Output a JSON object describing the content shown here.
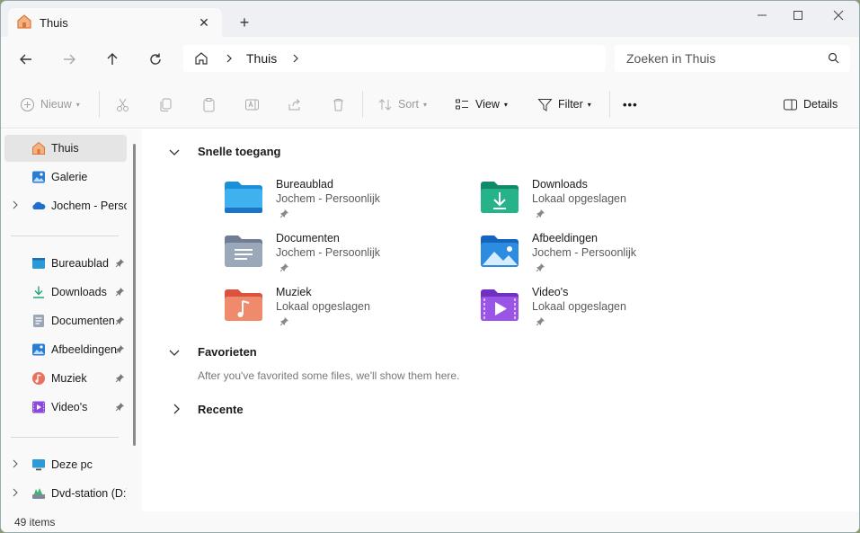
{
  "tab": {
    "title": "Thuis",
    "close": "✕",
    "new": "+"
  },
  "window": {
    "minimize": "—",
    "maximize": "☐",
    "close": "✕"
  },
  "nav": {
    "crumb": "Thuis"
  },
  "search": {
    "placeholder": "Zoeken in Thuis"
  },
  "toolbar": {
    "new": "Nieuw",
    "sort": "Sort",
    "view": "View",
    "filter": "Filter",
    "more": "•••",
    "details": "Details"
  },
  "sidebar": {
    "top": [
      {
        "label": "Thuis",
        "icon": "home-icon",
        "selected": true
      },
      {
        "label": "Galerie",
        "icon": "gallery-icon"
      },
      {
        "label": "Jochem - Persoonlijk",
        "icon": "onedrive-icon",
        "expandable": true
      }
    ],
    "pinned": [
      {
        "label": "Bureaublad",
        "icon": "desktop-icon"
      },
      {
        "label": "Downloads",
        "icon": "downloads-icon"
      },
      {
        "label": "Documenten",
        "icon": "documents-icon"
      },
      {
        "label": "Afbeeldingen",
        "icon": "pictures-icon"
      },
      {
        "label": "Muziek",
        "icon": "music-icon"
      },
      {
        "label": "Video's",
        "icon": "videos-icon"
      }
    ],
    "devices": [
      {
        "label": "Deze pc",
        "icon": "pc-icon"
      },
      {
        "label": "Dvd-station (D:)",
        "icon": "dvd-icon"
      }
    ]
  },
  "sections": {
    "quick": "Snelle toegang",
    "favorites": "Favorieten",
    "favorites_empty": "After you've favorited some files, we'll show them here.",
    "recent": "Recente"
  },
  "quick_access": [
    {
      "name": "Bureaublad",
      "sub": "Jochem - Persoonlijk",
      "icon": "desktop-folder-icon"
    },
    {
      "name": "Downloads",
      "sub": "Lokaal opgeslagen",
      "icon": "downloads-folder-icon"
    },
    {
      "name": "Documenten",
      "sub": "Jochem - Persoonlijk",
      "icon": "documents-folder-icon"
    },
    {
      "name": "Afbeeldingen",
      "sub": "Jochem - Persoonlijk",
      "icon": "pictures-folder-icon"
    },
    {
      "name": "Muziek",
      "sub": "Lokaal opgeslagen",
      "icon": "music-folder-icon"
    },
    {
      "name": "Video's",
      "sub": "Lokaal opgeslagen",
      "icon": "videos-folder-icon"
    }
  ],
  "status": {
    "count": "49 items"
  }
}
